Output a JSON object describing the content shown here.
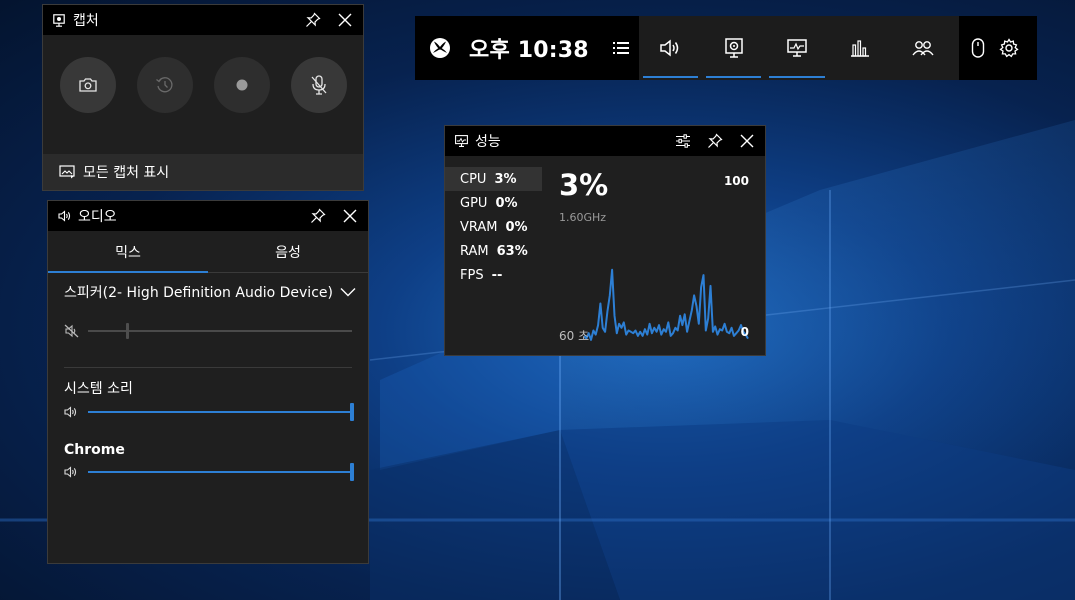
{
  "colors": {
    "accent": "#2d7fd4",
    "widget_bg": "#1f1f1f",
    "title_bg": "#000000"
  },
  "capture": {
    "title": "캡처",
    "buttons": [
      {
        "icon": "camera-icon"
      },
      {
        "icon": "record-last-icon"
      },
      {
        "icon": "record-dot-icon"
      },
      {
        "icon": "mic-off-icon"
      }
    ],
    "footer": "모든 캡처 표시"
  },
  "audio": {
    "title": "오디오",
    "tabs": [
      "믹스",
      "음성"
    ],
    "active_tab": 0,
    "device": "스피커(2- High Definition Audio Device)",
    "device_volume": 0.15,
    "device_muted": true,
    "apps": [
      {
        "label": "시스템 소리",
        "volume": 1.0
      },
      {
        "label": "Chrome",
        "volume": 1.0
      }
    ]
  },
  "gamebar": {
    "time": "오후 10:38",
    "tools": [
      {
        "icon": "speaker-icon",
        "active": true
      },
      {
        "icon": "capture-icon",
        "active": true
      },
      {
        "icon": "performance-icon",
        "active": true
      },
      {
        "icon": "bar-chart-icon",
        "active": false
      },
      {
        "icon": "social-icon",
        "active": false
      }
    ]
  },
  "performance": {
    "title": "성능",
    "items": [
      {
        "key": "CPU",
        "value": "3%"
      },
      {
        "key": "GPU",
        "value": "0%"
      },
      {
        "key": "VRAM",
        "value": "0%"
      },
      {
        "key": "RAM",
        "value": "63%"
      },
      {
        "key": "FPS",
        "value": "--"
      }
    ],
    "active_item": 0,
    "big_value": "3%",
    "clock": "1.60GHz",
    "max_label": "100",
    "min_label": "0",
    "window_label": "60 초",
    "history": [
      6,
      4,
      8,
      3,
      10,
      7,
      14,
      30,
      12,
      9,
      24,
      36,
      55,
      21,
      8,
      15,
      12,
      16,
      7,
      10,
      9,
      8,
      10,
      6,
      9,
      6,
      11,
      7,
      15,
      8,
      12,
      9,
      14,
      7,
      11,
      9,
      16,
      6,
      8,
      12,
      10,
      21,
      14,
      22,
      9,
      17,
      25,
      36,
      28,
      15,
      42,
      51,
      10,
      19,
      43,
      9,
      13,
      7,
      11,
      10,
      15,
      9,
      8,
      12,
      6,
      8,
      10,
      14,
      9,
      7,
      4
    ]
  }
}
